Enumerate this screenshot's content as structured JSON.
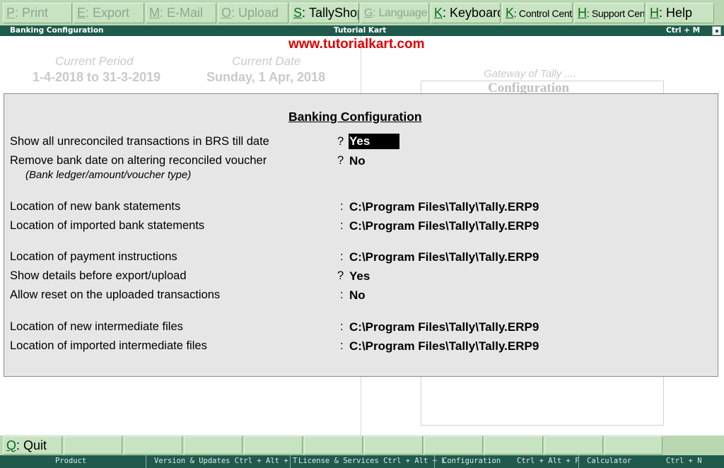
{
  "top_buttons": [
    {
      "key": "P",
      "label": "Print",
      "enabled": false
    },
    {
      "key": "E",
      "label": "Export",
      "enabled": false
    },
    {
      "key": "M",
      "label": "E-Mail",
      "enabled": false
    },
    {
      "key": "O",
      "label": "Upload",
      "enabled": false
    },
    {
      "key": "S",
      "label": "TallyShop",
      "enabled": true
    },
    {
      "key": "G",
      "label": "Language",
      "enabled": false
    },
    {
      "key": "K",
      "label": "Keyboard",
      "enabled": true
    },
    {
      "key": "K",
      "label": "Control Centre",
      "enabled": true
    },
    {
      "key": "H",
      "label": "Support Centre",
      "enabled": true
    },
    {
      "key": "H",
      "label": "Help",
      "enabled": true
    }
  ],
  "titlebar": {
    "left": "Banking Configuration",
    "center": "Tutorial Kart",
    "right": "Ctrl + M"
  },
  "background": {
    "watermark": "www.tutorialkart.com",
    "current_period_label": "Current Period",
    "current_period_value": "1-4-2018 to 31-3-2019",
    "current_date_label": "Current Date",
    "current_date_value": "Sunday, 1 Apr, 2018",
    "gateway_label": "Gateway of Tally ....",
    "gateway_box_title": "Configuration"
  },
  "dialog": {
    "title": "Banking Configuration",
    "subnote": "(Bank ledger/amount/voucher type)",
    "rows": [
      {
        "label": "Show all unreconciled transactions in BRS till date",
        "sep": "?",
        "value": "Yes"
      },
      {
        "label": "Remove bank date on altering reconciled voucher",
        "sep": "?",
        "value": "No"
      },
      {
        "label": "Location of new bank statements",
        "sep": ":",
        "value": "C:\\Program Files\\Tally\\Tally.ERP9"
      },
      {
        "label": "Location of imported bank statements",
        "sep": ":",
        "value": "C:\\Program Files\\Tally\\Tally.ERP9"
      },
      {
        "label": "Location of payment instructions",
        "sep": ":",
        "value": "C:\\Program Files\\Tally\\Tally.ERP9"
      },
      {
        "label": "Show details before export/upload",
        "sep": "?",
        "value": "Yes"
      },
      {
        "label": "Allow reset on the uploaded transactions",
        "sep": ":",
        "value": "No"
      },
      {
        "label": "Location of new intermediate files",
        "sep": ":",
        "value": "C:\\Program Files\\Tally\\Tally.ERP9"
      },
      {
        "label": "Location of imported intermediate files",
        "sep": ":",
        "value": "C:\\Program Files\\Tally\\Tally.ERP9"
      }
    ]
  },
  "bottom": {
    "quit_key": "Q",
    "quit_label": "Quit"
  },
  "statusbar": {
    "product": "Product",
    "version": "Version & Updates Ctrl + Alt + T",
    "license": "License & Services Ctrl + Alt + L",
    "configuration": "Configuration",
    "configuration_shortcut": "Ctrl + Alt + F",
    "calculator": "Calculator",
    "calculator_shortcut": "Ctrl + N"
  }
}
